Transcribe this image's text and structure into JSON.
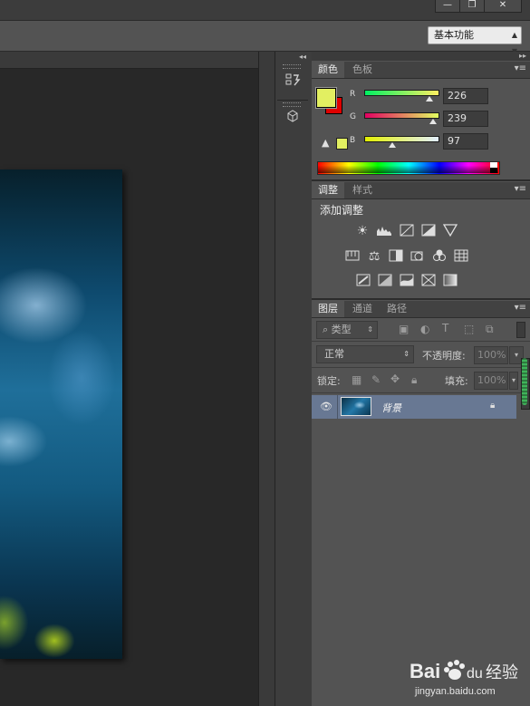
{
  "window": {
    "minimize_glyph": "—",
    "restore_glyph": "❐",
    "close_glyph": "✕"
  },
  "options_bar": {
    "workspace_value": "基本功能"
  },
  "icons": [
    "history-icon",
    "3d-icon",
    "eye-icon",
    "lock-icon",
    "warning-icon",
    "search-icon",
    "brightness-icon",
    "levels-icon",
    "curves-icon",
    "exposure-icon",
    "vibrance-icon",
    "hue-saturation-icon",
    "color-balance-icon",
    "black-white-icon",
    "photo-filter-icon",
    "channel-mixer-icon",
    "color-lookup-icon",
    "invert-icon",
    "posterize-icon",
    "threshold-icon",
    "gradient-map-icon",
    "selective-color-icon"
  ],
  "color_panel": {
    "tabs": [
      {
        "label": "颜色"
      },
      {
        "label": "色板"
      }
    ],
    "foreground": "#e2ef61",
    "background": "#e00000",
    "channels": [
      {
        "label": "R",
        "value": "226"
      },
      {
        "label": "G",
        "value": "239"
      },
      {
        "label": "B",
        "value": "97"
      }
    ],
    "channel_levels": [
      0.886,
      0.937,
      0.38
    ]
  },
  "adjustments_panel": {
    "tabs": [
      {
        "label": "调整"
      },
      {
        "label": "样式"
      }
    ],
    "title": "添加调整"
  },
  "layers_panel": {
    "tabs": [
      {
        "label": "图层"
      },
      {
        "label": "通道"
      },
      {
        "label": "路径"
      }
    ],
    "filter_kind": "类型",
    "blend_mode": "正常",
    "opacity_label": "不透明度:",
    "opacity_value": "100%",
    "lock_label": "锁定:",
    "fill_label": "填充:",
    "fill_value": "100%",
    "layers": [
      {
        "name": "背景",
        "visible": true,
        "locked": true
      }
    ]
  },
  "watermark": {
    "brand": "Bai",
    "brand2": "du",
    "cn": "经验",
    "url": "jingyan.baidu.com"
  }
}
